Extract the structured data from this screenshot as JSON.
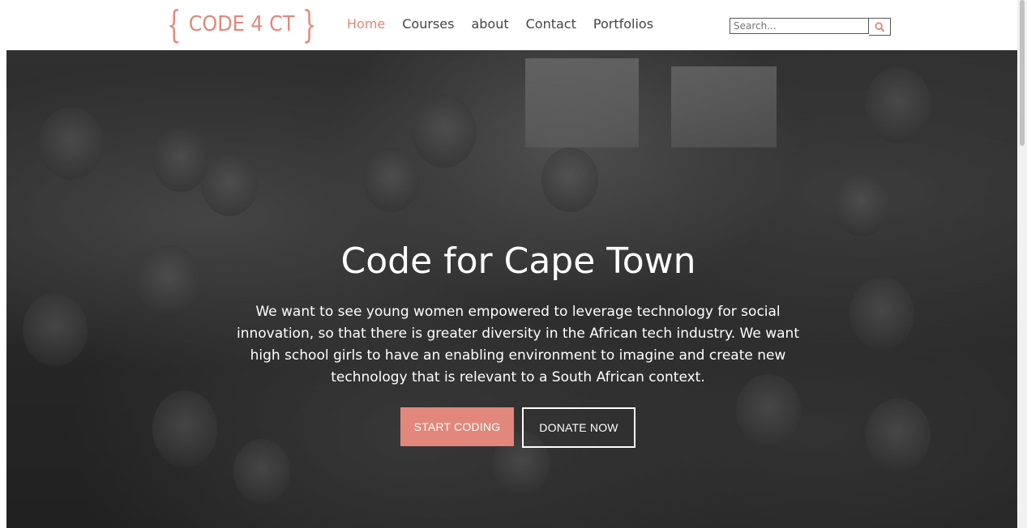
{
  "logo": {
    "open_brace": "{",
    "text": "CODE 4 CT",
    "close_brace": "}"
  },
  "nav": {
    "items": [
      {
        "label": "Home",
        "active": true
      },
      {
        "label": "Courses",
        "active": false
      },
      {
        "label": "about",
        "active": false
      },
      {
        "label": "Contact",
        "active": false
      },
      {
        "label": "Portfolios",
        "active": false
      }
    ]
  },
  "search": {
    "placeholder": "Search...",
    "icon": "search-icon"
  },
  "hero": {
    "title": "Code for Cape Town",
    "description": "We want to see young women empowered to leverage technology for social innovation, so that there is greater diversity in the African tech industry. We want high school girls to have an enabling environment to imagine and create new technology that is relevant to a South African context.",
    "primary_button": "START CODING",
    "secondary_button": "DONATE NOW"
  },
  "colors": {
    "accent": "#e2877b",
    "text_dark": "#444444"
  }
}
